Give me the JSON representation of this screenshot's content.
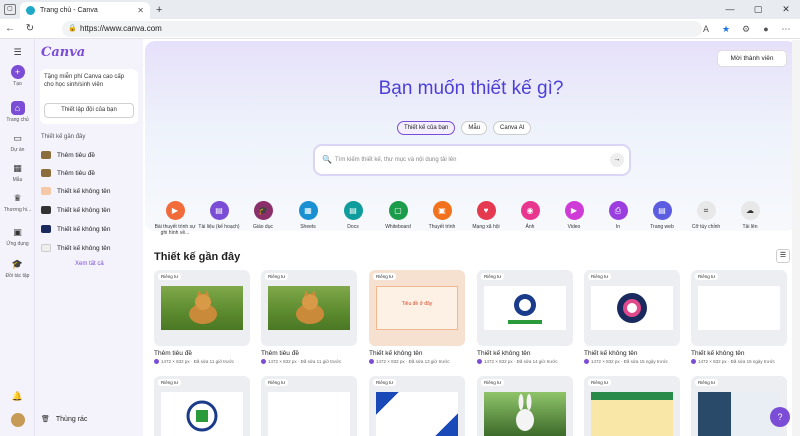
{
  "browser": {
    "tab_title": "Trang chủ - Canva",
    "url": "https://www.canva.com"
  },
  "rail": [
    "Tạo",
    "Trang chủ",
    "Dự án",
    "Mẫu",
    "Thương hi...",
    "Ứng dụng",
    "Đồi tác tập"
  ],
  "sidebar": {
    "logo": "Canva",
    "promo_text": "Tặng miễn phí Canva cao cấp cho học sinh/sinh viên",
    "promo_button": "Thiết lập đội của bạn",
    "recent_heading": "Thiết kế gần đây",
    "recent": [
      "Thêm tiêu đề",
      "Thêm tiêu đề",
      "Thiết kế không tên",
      "Thiết kế không tên",
      "Thiết kế không tên",
      "Thiết kế không tên"
    ],
    "see_all": "Xem tất cả",
    "trash": "Thùng rác"
  },
  "hero": {
    "invite": "Mời thành viên",
    "heading": "Bạn muốn thiết kế gì?",
    "chips": [
      "Thiết kế của bạn",
      "Mẫu",
      "Canva AI"
    ],
    "search_placeholder": "Tìm kiếm thiết kế, thư mục và nội dung tải lên"
  },
  "categories": [
    {
      "label": "Bài thuyết trình sự ghi hình về...",
      "color": "#f26b3a"
    },
    {
      "label": "Tài liệu (kế hoạch)",
      "color": "#7b4dd6"
    },
    {
      "label": "Giáo dục",
      "color": "#8b2f6a"
    },
    {
      "label": "Sheets",
      "color": "#1a8fd1"
    },
    {
      "label": "Docs",
      "color": "#0f9c9c"
    },
    {
      "label": "Whiteboard",
      "color": "#1a9c4a"
    },
    {
      "label": "Thuyết trình",
      "color": "#f2711c"
    },
    {
      "label": "Mạng xã hội",
      "color": "#e53950"
    },
    {
      "label": "Ảnh",
      "color": "#e8368f"
    },
    {
      "label": "Video",
      "color": "#cf3bd6"
    },
    {
      "label": "In",
      "color": "#9b3ee0"
    },
    {
      "label": "Trang web",
      "color": "#5c5ce0"
    },
    {
      "label": "Cỡ tùy chỉnh",
      "color": "#555555"
    },
    {
      "label": "Tải lên",
      "color": "#555555"
    }
  ],
  "recent_section": "Thiết kế gần đây",
  "badge": "Riêng tư",
  "cards_row1": [
    {
      "title": "Thêm tiêu đề",
      "meta": "1472 × 832 px · Đã sửa 11 giờ trước"
    },
    {
      "title": "Thêm tiêu đề",
      "meta": "1472 × 832 px · Đã sửa 11 giờ trước"
    },
    {
      "title": "Thiết kế không tên",
      "meta": "1472 × 832 px · Đã sửa 13 giờ trước"
    },
    {
      "title": "Thiết kế không tên",
      "meta": "1472 × 832 px · Đã sửa 14 giờ trước"
    },
    {
      "title": "Thiết kế không tên",
      "meta": "1472 × 832 px · Đã sửa 15 ngày trước"
    },
    {
      "title": "Thiết kế không tên",
      "meta": "1472 × 832 px · Đã sửa 15 ngày trước"
    }
  ],
  "thumb_text_card3": "Tiêu đề ở đây",
  "help": "?"
}
